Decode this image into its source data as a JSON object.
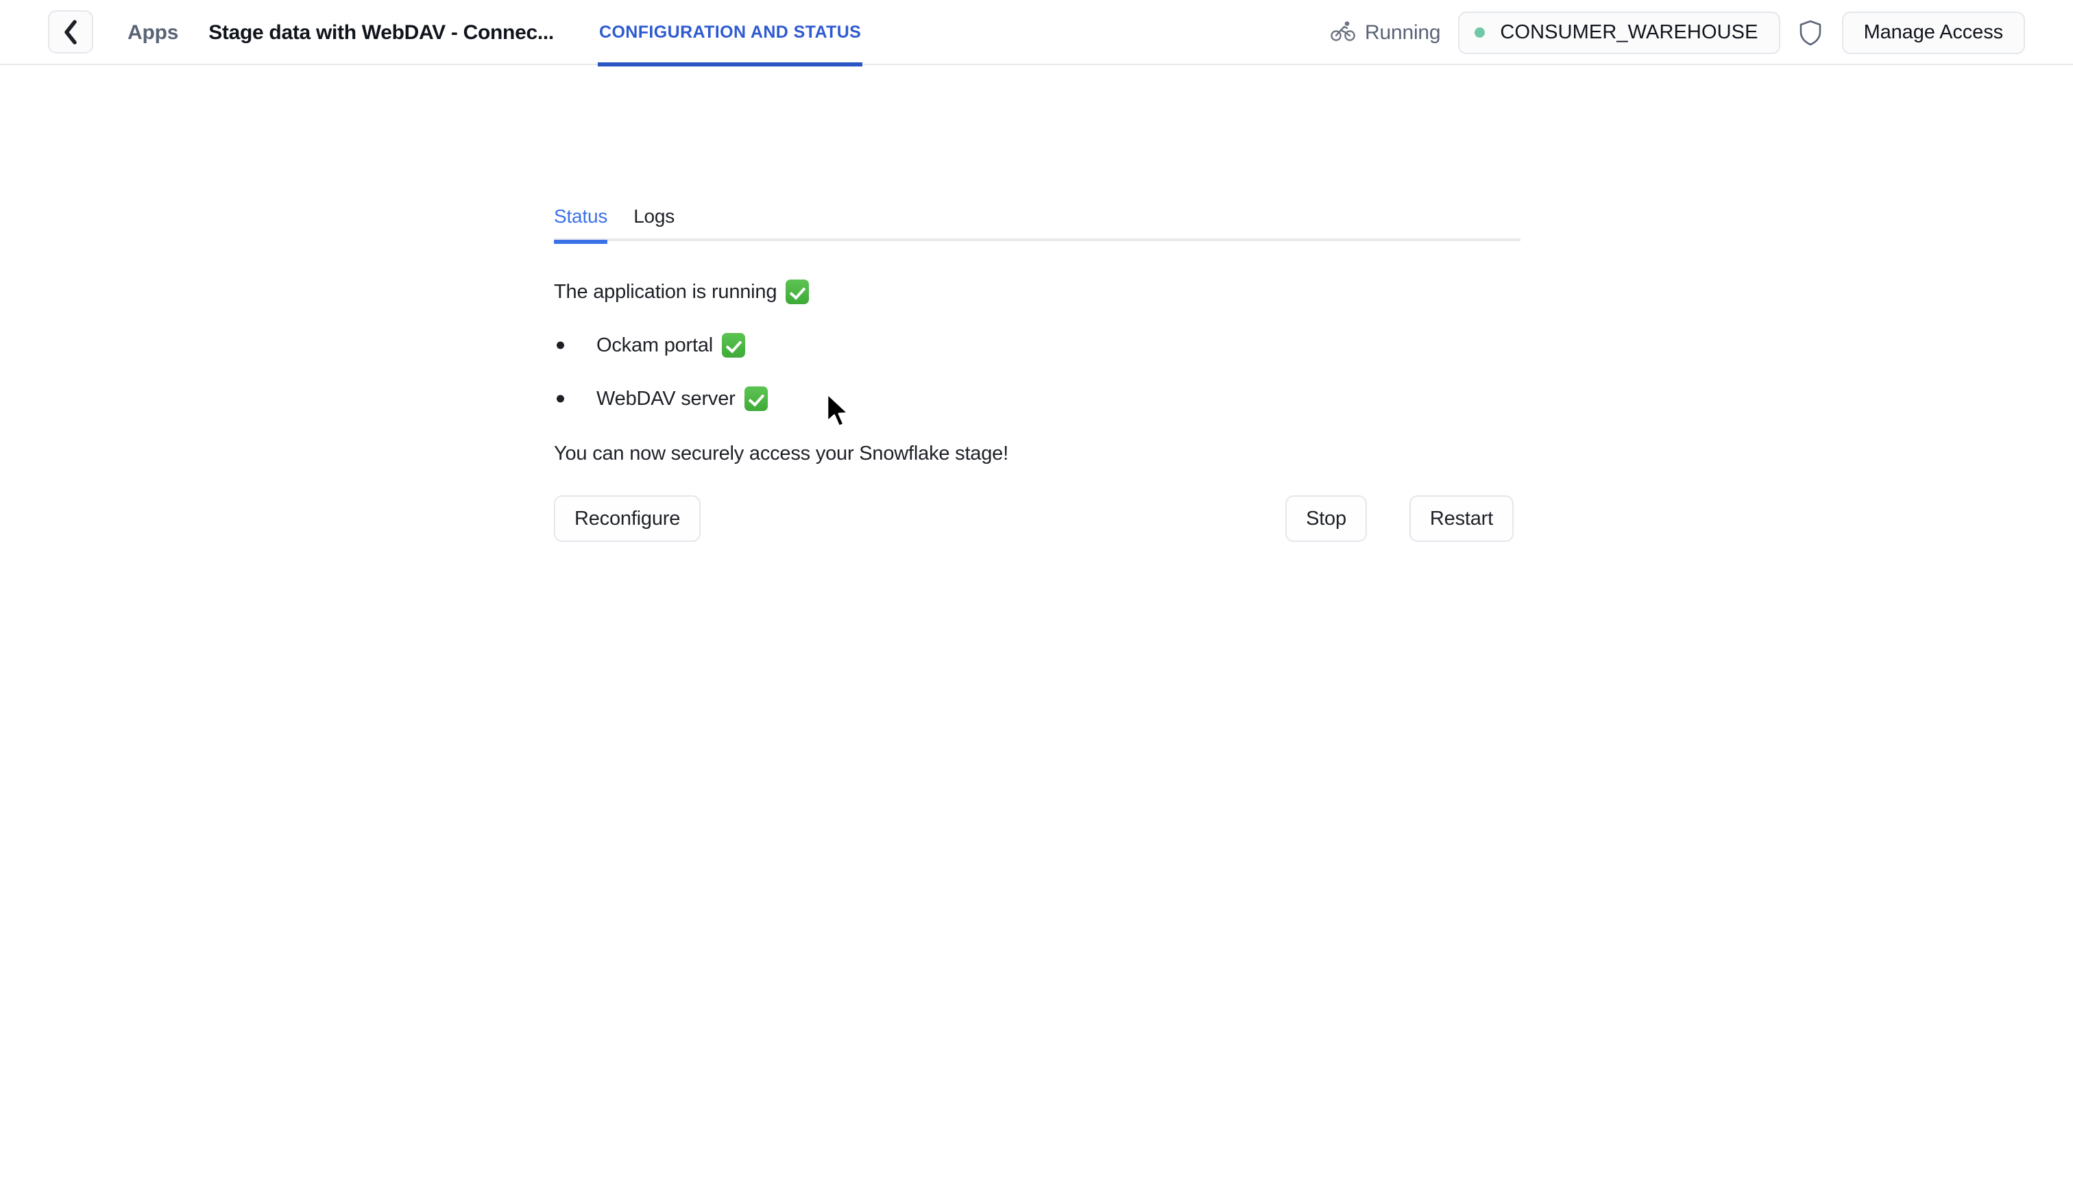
{
  "header": {
    "back_icon": "chevron-left-icon",
    "breadcrumb_apps": "Apps",
    "title": "Stage data with WebDAV - Connec...",
    "tab": {
      "label": "CONFIGURATION AND STATUS",
      "active": true,
      "accent": "#2a55c4"
    },
    "running": {
      "icon": "biking-icon",
      "label": "Running"
    },
    "warehouse": {
      "name": "CONSUMER_WAREHOUSE",
      "status_dot_color": "#6fc9a7"
    },
    "shield_icon": "shield-icon",
    "manage_access_label": "Manage Access"
  },
  "content": {
    "tabs": [
      {
        "label": "Status",
        "active": true
      },
      {
        "label": "Logs",
        "active": false
      }
    ],
    "accent": "#3b71e8",
    "status_headline": "The application is running",
    "status_headline_check": "check-mark-button",
    "components": [
      {
        "label": "Ockam portal",
        "status": "check-mark-button"
      },
      {
        "label": "WebDAV server",
        "status": "check-mark-button"
      }
    ],
    "closing_message": "You can now securely access your Snowflake stage!",
    "buttons": {
      "reconfigure": "Reconfigure",
      "stop": "Stop",
      "restart": "Restart"
    }
  }
}
